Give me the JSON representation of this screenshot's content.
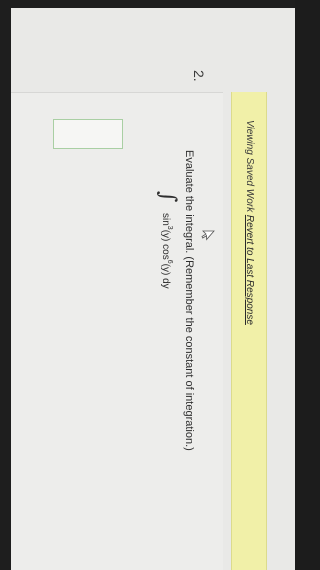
{
  "question": {
    "number": "2."
  },
  "banner": {
    "prefix": "Viewing Saved Work ",
    "link_text": "Revert to Last Response"
  },
  "prompt": {
    "text": "Evaluate the integral. (Remember the constant of integration.)"
  },
  "integral": {
    "sign": "∫",
    "sin_label": "sin",
    "sin_power": "3",
    "sin_arg": "(y) ",
    "cos_label": "cos",
    "cos_power": "6",
    "cos_arg": "(y) dy"
  },
  "answer": {
    "value": ""
  },
  "colors": {
    "banner_bg": "#f1f0a8",
    "answer_border": "#a9cfa3",
    "page_bg": "#e9e9e7"
  },
  "icons": {
    "pointer": "mouse-pointer-icon"
  }
}
